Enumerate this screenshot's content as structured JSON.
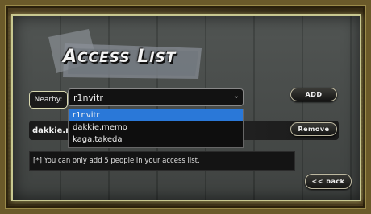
{
  "dialog": {
    "title_first_initial": "A",
    "title_first_rest": "CCESS",
    "title_second_initial": "L",
    "title_second_rest": "IST"
  },
  "nearby": {
    "label": "Nearby:",
    "selected": "r1nvitr",
    "options": [
      "r1nvitr",
      "dakkie.memo",
      "kaga.takeda"
    ]
  },
  "access_list": {
    "entries": [
      "dakkie.memo"
    ]
  },
  "buttons": {
    "add": "ADD",
    "remove": "Remove",
    "back": "<< back"
  },
  "note": "[*] You can only add 5 people in your access list.",
  "icons": {
    "dropdown": "chevron-down-icon"
  },
  "colors": {
    "highlight": "#2a78d8",
    "frame_glow": "#c8c890"
  }
}
